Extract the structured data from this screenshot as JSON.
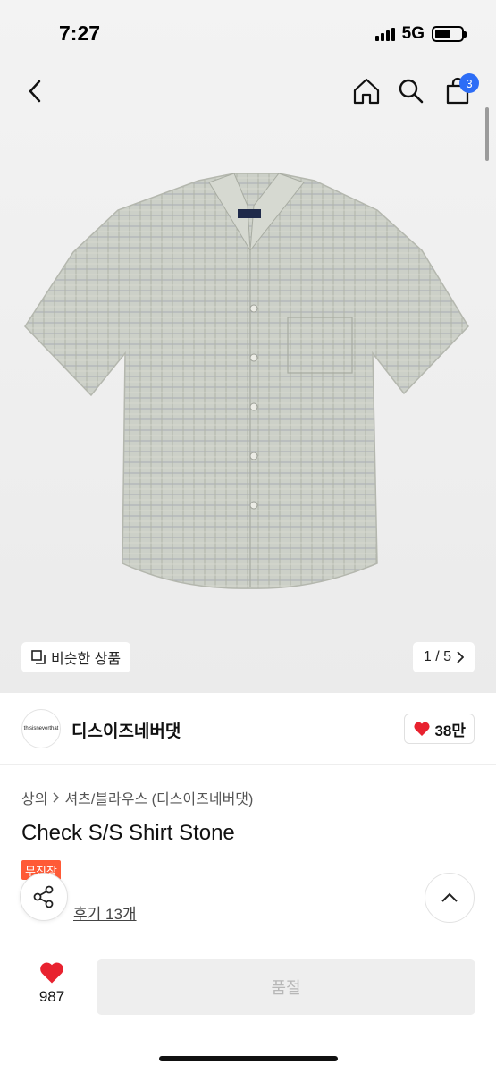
{
  "status": {
    "time": "7:27",
    "network": "5G"
  },
  "header": {
    "cart_count": "3"
  },
  "gallery": {
    "similar_label": "비슷한 상품",
    "page_indicator": "1 / 5"
  },
  "brand": {
    "logo_text": "thisisneverthat",
    "name": "디스이즈네버댓",
    "likes": "38만"
  },
  "breadcrumb": {
    "level1": "상의",
    "level2": "셔츠/블라우스 (디스이즈네버댓)"
  },
  "product": {
    "title": "Check S/S Shirt Stone",
    "tag": "무진장",
    "review_link": "후기 13개"
  },
  "bottom": {
    "like_count": "987",
    "buy_label": "품절"
  },
  "colors": {
    "accent_badge": "#2d6df6",
    "heart": "#e8222f",
    "tag": "#ff5a36",
    "shirt": "#c9ccc4"
  }
}
